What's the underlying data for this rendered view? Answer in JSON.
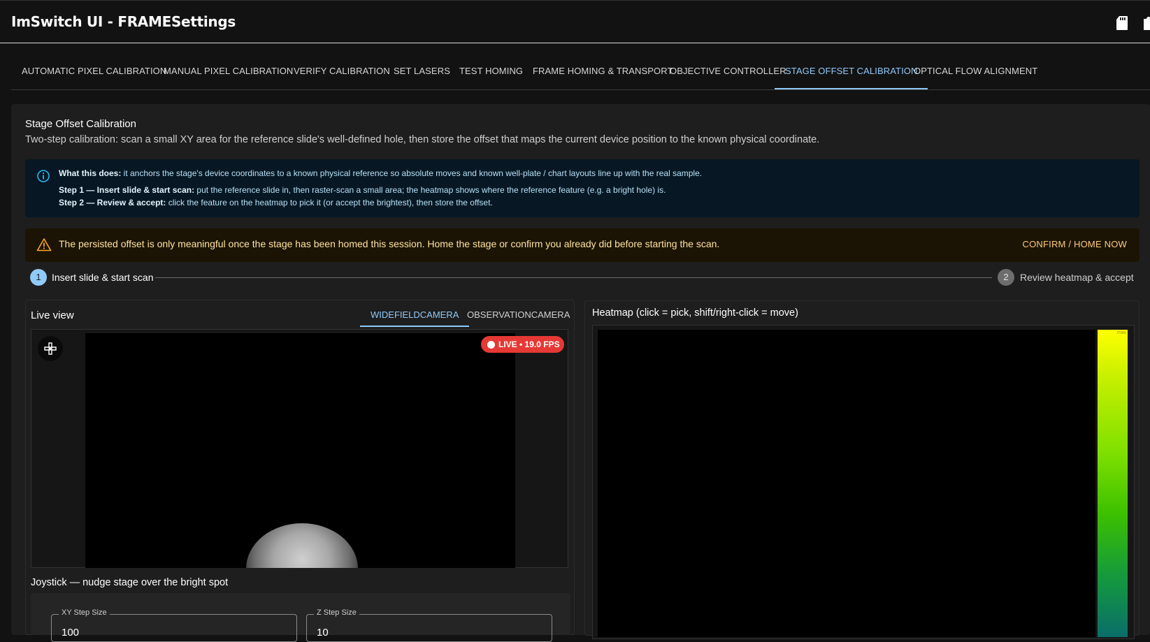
{
  "app": {
    "title": "ImSwitch UI - FRAMESettings"
  },
  "tabs": [
    {
      "label": "Automatic Pixel Calibration"
    },
    {
      "label": "Manual Pixel Calibration"
    },
    {
      "label": "Verify Calibration"
    },
    {
      "label": "Set Lasers"
    },
    {
      "label": "Test Homing"
    },
    {
      "label": "Frame Homing & Transport"
    },
    {
      "label": "Objective Controller"
    },
    {
      "label": "Stage Offset Calibration",
      "active": true
    },
    {
      "label": "Optical Flow Alignment"
    }
  ],
  "section": {
    "title": "Stage Offset Calibration",
    "description": "Two-step calibration: scan a small XY area for the reference slide's well-defined hole, then store the offset that maps the current device position to the known physical coordinate."
  },
  "info": {
    "line1_bold": "What this does:",
    "line1_text": " it anchors the stage's device coordinates to a known physical reference so absolute moves and known well-plate / chart layouts line up with the real sample.",
    "line2_bold": "Step 1 — Insert slide & start scan:",
    "line2_text": " put the reference slide in, then raster-scan a small area; the heatmap shows where the reference feature (e.g. a bright hole) is.",
    "line3_bold": "Step 2 — Review & accept:",
    "line3_text": " click the feature on the heatmap to pick it (or accept the brightest), then store the offset."
  },
  "warning": {
    "text": "The persisted offset is only meaningful once the stage has been homed this session. Home the stage or confirm you already did before starting the scan.",
    "button": "Confirm / Home now"
  },
  "stepper": {
    "steps": [
      {
        "num": "1",
        "label": "Insert slide & start scan",
        "active": true
      },
      {
        "num": "2",
        "label": "Review heatmap & accept",
        "active": false
      }
    ]
  },
  "live": {
    "title": "Live view",
    "cameras": [
      {
        "label": "WidefieldCamera",
        "active": true
      },
      {
        "label": "ObservationCamera",
        "active": false
      }
    ],
    "badge": "LIVE • 19.0 FPS"
  },
  "joystick": {
    "title": "Joystick — nudge stage over the bright spot",
    "xy_label": "XY Step Size",
    "xy_value": "100",
    "z_label": "Z Step Size",
    "z_value": "10"
  },
  "heatmap": {
    "title": "Heatmap (click = pick, shift/right-click = move)",
    "colorbar_max": "max"
  },
  "colors": {
    "accent": "#90caf9",
    "live_badge": "#e53935",
    "warning_text": "#ffe3a0",
    "info_bg": "#071824"
  },
  "icons": [
    "sd-card-icon",
    "puzzle-icon",
    "info-icon",
    "warning-icon",
    "gamepad-icon"
  ]
}
